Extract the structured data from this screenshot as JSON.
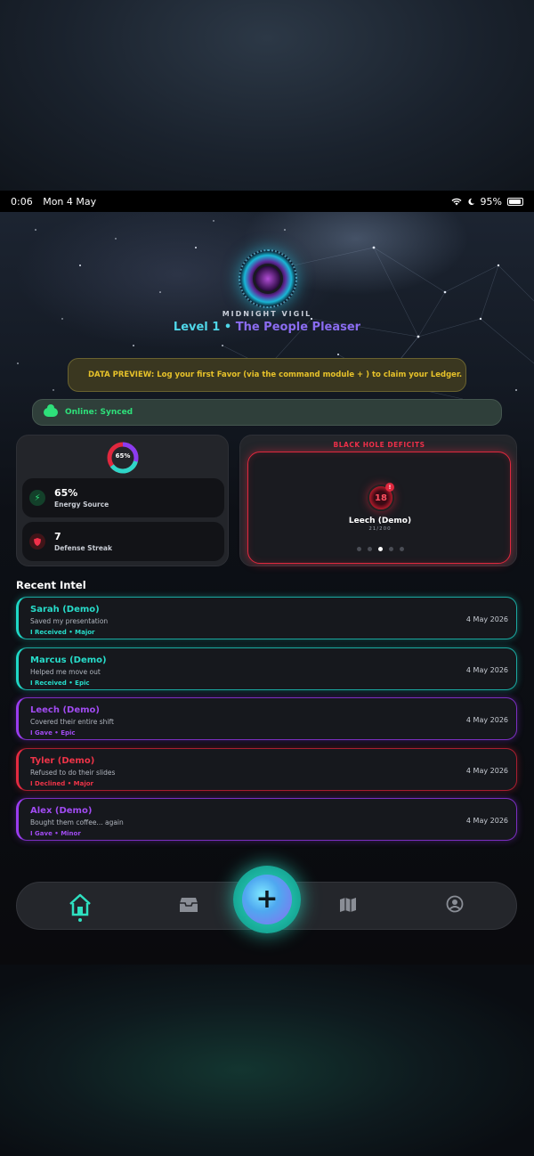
{
  "status_bar": {
    "time": "0:06",
    "date": "Mon 4 May",
    "battery": "95%"
  },
  "hero": {
    "subtitle": "MIDNIGHT VIGIL",
    "level": "Level 1",
    "separator": " • ",
    "rank": "The People Pleaser"
  },
  "preview_banner": {
    "icon": "vault-icon",
    "text": "DATA PREVIEW: Log your first Favor (via the command module + ) to claim your Ledger."
  },
  "sync": {
    "icon": "cloud-icon",
    "text": "Online: Synced"
  },
  "stats": {
    "ring_percent": 65,
    "ring_label": "65%",
    "energy_value": "65%",
    "energy_label": "Energy Source",
    "defense_value": "7",
    "defense_label": "Defense Streak"
  },
  "deficits": {
    "title": "BLACK HOLE DEFICITS",
    "avatar_value": "18",
    "badge": "!",
    "name": "Leech (Demo)",
    "score": "21/200",
    "page_count": 5,
    "active_page": 3
  },
  "recent": {
    "title": "Recent Intel",
    "items": [
      {
        "name": "Sarah (Demo)",
        "note": "Saved my presentation",
        "direction": "I Received",
        "size": "Major",
        "date": "4 May 2026",
        "color": "#27dcca"
      },
      {
        "name": "Marcus (Demo)",
        "note": "Helped me move out",
        "direction": "I Received",
        "size": "Epic",
        "date": "4 May 2026",
        "color": "#27dcca"
      },
      {
        "name": "Leech (Demo)",
        "note": "Covered their entire shift",
        "direction": "I Gave",
        "size": "Epic",
        "date": "4 May 2026",
        "color": "#a14bf2"
      },
      {
        "name": "Tyler (Demo)",
        "note": "Refused to do their slides",
        "direction": "I Declined",
        "size": "Major",
        "date": "4 May 2026",
        "color": "#ee3448"
      },
      {
        "name": "Alex (Demo)",
        "note": "Bought them coffee... again",
        "direction": "I Gave",
        "size": "Minor",
        "date": "4 May 2026",
        "color": "#a14bf2"
      }
    ]
  },
  "tag_separator": " • ",
  "nav": {
    "items": [
      "home-icon",
      "inbox-icon",
      "add-icon",
      "map-icon",
      "profile-icon"
    ],
    "active": "home-icon",
    "fab_label": "+"
  },
  "colors": {
    "teal": "#27dcca",
    "purple": "#a14bf2",
    "red": "#ee3448",
    "green": "#2ee07a",
    "gold": "#e7c22a"
  }
}
